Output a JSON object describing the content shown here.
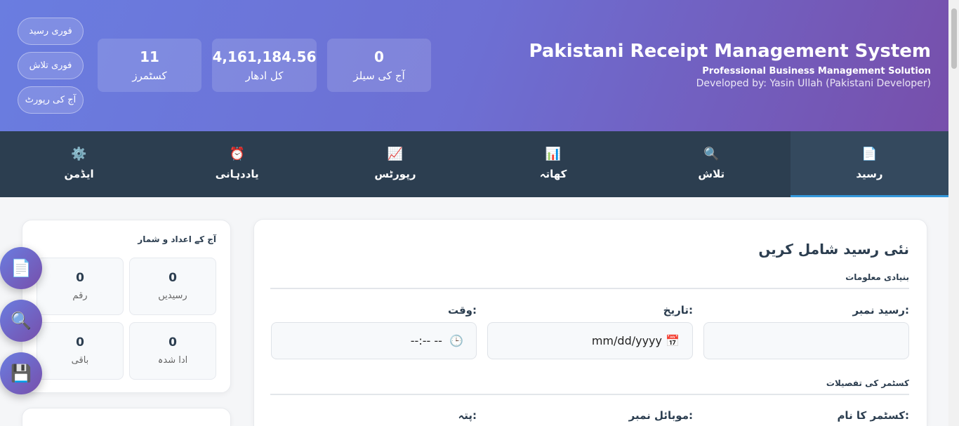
{
  "header": {
    "title": "Pakistani Receipt Management System",
    "subtitle": "Professional Business Management Solution",
    "developer": "Developed by: Yasin Ullah (Pakistani Developer)"
  },
  "stats": [
    {
      "value": "0",
      "label": "آج کی سیلز"
    },
    {
      "value": "4,161,184.56",
      "label": "کل ادھار"
    },
    {
      "value": "11",
      "label": "کسٹمرز"
    }
  ],
  "quick_buttons": [
    "فوری رسید",
    "فوری تلاش",
    "آج کی رپورٹ"
  ],
  "tabs": [
    {
      "icon": "📄",
      "label": "رسید"
    },
    {
      "icon": "🔍",
      "label": "تلاش"
    },
    {
      "icon": "📊",
      "label": "کھاتہ"
    },
    {
      "icon": "📈",
      "label": "رپورٹس"
    },
    {
      "icon": "⏰",
      "label": "یاددہانی"
    },
    {
      "icon": "⚙️",
      "label": "ایڈمن"
    }
  ],
  "today_stats": {
    "title": "آج کے اعداد و شمار",
    "items": [
      {
        "value": "0",
        "label": "رسیدیں"
      },
      {
        "value": "0",
        "label": "رقم"
      },
      {
        "value": "0",
        "label": "ادا شدہ"
      },
      {
        "value": "0",
        "label": "باقی"
      }
    ]
  },
  "fabs": [
    "📄",
    "🔍",
    "💾"
  ],
  "form": {
    "title": "نئی رسید شامل کریں",
    "basic_section": "بنیادی معلومات",
    "receipt_no_label": "رسید نمبر:",
    "receipt_no_value": "",
    "date_label": "تاریخ:",
    "date_value": "mm/dd/yyyy",
    "time_label": "وقت:",
    "time_value": "--:-- --",
    "customer_section": "کسٹمر کی تفصیلات",
    "customer_name_label": "کسٹمر کا نام:",
    "mobile_label": "موبائل نمبر:",
    "address_label": "پتہ:"
  }
}
